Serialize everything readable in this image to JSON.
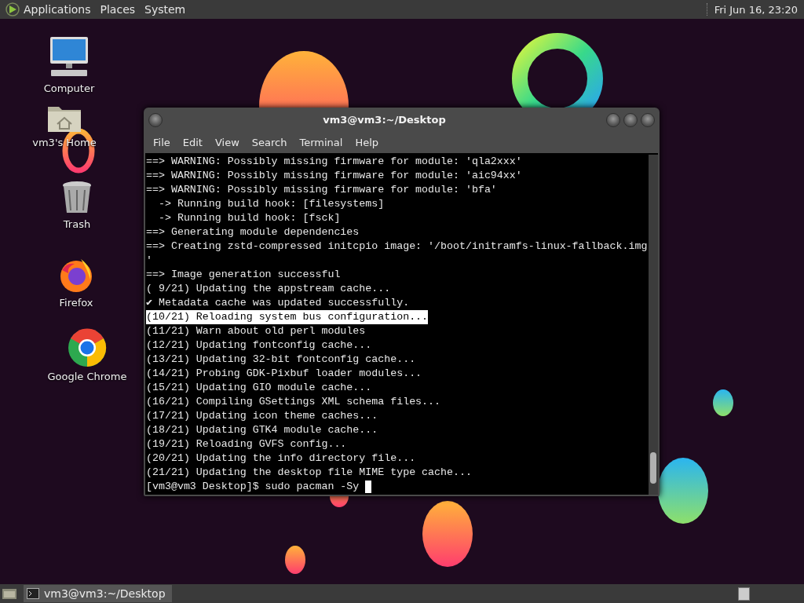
{
  "top_panel": {
    "menus": [
      {
        "label": "Applications",
        "kind": "apps"
      },
      {
        "label": "Places",
        "kind": "plain"
      },
      {
        "label": "System",
        "kind": "plain"
      }
    ],
    "clock": "Fri Jun 16, 23:20"
  },
  "desktop_icons": [
    {
      "label": "Computer",
      "kind": "computer"
    },
    {
      "label": "vm3's Home",
      "kind": "home"
    },
    {
      "label": "Trash",
      "kind": "trash"
    },
    {
      "label": "Firefox",
      "kind": "firefox"
    },
    {
      "label": "Google Chrome",
      "kind": "chrome"
    }
  ],
  "window": {
    "title": "vm3@vm3:~/Desktop",
    "menu": [
      "File",
      "Edit",
      "View",
      "Search",
      "Terminal",
      "Help"
    ],
    "lines": [
      {
        "text": "==> WARNING: Possibly missing firmware for module: 'qla2xxx'",
        "selected": false
      },
      {
        "text": "==> WARNING: Possibly missing firmware for module: 'aic94xx'",
        "selected": false
      },
      {
        "text": "==> WARNING: Possibly missing firmware for module: 'bfa'",
        "selected": false
      },
      {
        "text": "  -> Running build hook: [filesystems]",
        "selected": false
      },
      {
        "text": "  -> Running build hook: [fsck]",
        "selected": false
      },
      {
        "text": "==> Generating module dependencies",
        "selected": false
      },
      {
        "text": "==> Creating zstd-compressed initcpio image: '/boot/initramfs-linux-fallback.img",
        "selected": false
      },
      {
        "text": "'",
        "selected": false
      },
      {
        "text": "==> Image generation successful",
        "selected": false
      },
      {
        "text": "( 9/21) Updating the appstream cache...",
        "selected": false
      },
      {
        "text": "✔ Metadata cache was updated successfully.",
        "selected": false
      },
      {
        "text": "(10/21) Reloading system bus configuration...",
        "selected": true
      },
      {
        "text": "(11/21) Warn about old perl modules",
        "selected": false
      },
      {
        "text": "(12/21) Updating fontconfig cache...",
        "selected": false
      },
      {
        "text": "(13/21) Updating 32-bit fontconfig cache...",
        "selected": false
      },
      {
        "text": "(14/21) Probing GDK-Pixbuf loader modules...",
        "selected": false
      },
      {
        "text": "(15/21) Updating GIO module cache...",
        "selected": false
      },
      {
        "text": "(16/21) Compiling GSettings XML schema files...",
        "selected": false
      },
      {
        "text": "(17/21) Updating icon theme caches...",
        "selected": false
      },
      {
        "text": "(18/21) Updating GTK4 module cache...",
        "selected": false
      },
      {
        "text": "(19/21) Reloading GVFS config...",
        "selected": false
      },
      {
        "text": "(20/21) Updating the info directory file...",
        "selected": false
      },
      {
        "text": "(21/21) Updating the desktop file MIME type cache...",
        "selected": false
      }
    ],
    "prompt": "[vm3@vm3 Desktop]$ sudo pacman -Sy"
  },
  "taskbar": {
    "tasks": [
      {
        "label": "vm3@vm3:~/Desktop",
        "selected": true
      }
    ]
  }
}
